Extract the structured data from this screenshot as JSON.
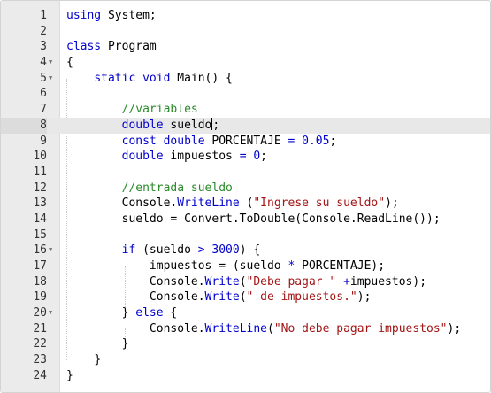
{
  "editor": {
    "lines": [
      {
        "num": "1"
      },
      {
        "num": "2"
      },
      {
        "num": "3"
      },
      {
        "num": "4",
        "fold": "▼"
      },
      {
        "num": "5",
        "fold": "▼"
      },
      {
        "num": "6"
      },
      {
        "num": "7"
      },
      {
        "num": "8"
      },
      {
        "num": "9"
      },
      {
        "num": "10"
      },
      {
        "num": "11"
      },
      {
        "num": "12"
      },
      {
        "num": "13"
      },
      {
        "num": "14"
      },
      {
        "num": "15"
      },
      {
        "num": "16",
        "fold": "▼"
      },
      {
        "num": "17"
      },
      {
        "num": "18"
      },
      {
        "num": "19"
      },
      {
        "num": "20",
        "fold": "▼"
      },
      {
        "num": "21"
      },
      {
        "num": "22"
      },
      {
        "num": "23"
      },
      {
        "num": "24"
      }
    ],
    "code": {
      "l1": {
        "kw": "using",
        "rest": " System;"
      },
      "l3": {
        "kw": "class",
        "rest": " Program"
      },
      "l4": "{",
      "l5": {
        "kw1": "static",
        "kw2": "void",
        "rest": " Main() {"
      },
      "l7": "//variables",
      "l8": {
        "kw": "double",
        "rest": " sueldo",
        "end": ";"
      },
      "l9": {
        "kw1": "const",
        "kw2": "double",
        "rest": " PORCENTAJE ",
        "op": "=",
        "sp": " ",
        "num": "0.05",
        "end": ";"
      },
      "l10": {
        "kw": "double",
        "rest": " impuestos ",
        "op": "=",
        "sp": " ",
        "num": "0",
        "end": ";"
      },
      "l12": "//entrada sueldo",
      "l13": {
        "a": "Console.",
        "fn": "WriteLine",
        "b": " (",
        "str": "\"Ingrese su sueldo\"",
        "c": ");"
      },
      "l14": "sueldo = Convert.ToDouble(Console.ReadLine());",
      "l16": {
        "kw": "if",
        "a": " (sueldo ",
        "op": ">",
        "b": " ",
        "num": "3000",
        "c": ") {"
      },
      "l17": {
        "a": "impuestos = (sueldo ",
        "op": "*",
        "b": " PORCENTAJE);"
      },
      "l18": {
        "a": "Console.",
        "fn": "Write",
        "b": "(",
        "str": "\"Debe pagar \"",
        "c": " ",
        "op": "+",
        "d": "impuestos);"
      },
      "l19": {
        "a": "Console.",
        "fn": "Write",
        "b": "(",
        "str": "\" de impuestos.\"",
        "c": ");"
      },
      "l20": {
        "a": "} ",
        "kw": "else",
        "b": " {"
      },
      "l21": {
        "a": "Console.",
        "fn": "WriteLine",
        "b": "(",
        "str": "\"No debe pagar impuestos\"",
        "c": ");"
      },
      "l22": "}",
      "l23": "}",
      "l24": "}"
    },
    "active_line": "8",
    "colors": {
      "keyword": "#0000cc",
      "string": "#a31515",
      "comment": "#2a8a2a",
      "gutter": "#ebebeb"
    },
    "fold_icon": "chevron-down-icon"
  }
}
